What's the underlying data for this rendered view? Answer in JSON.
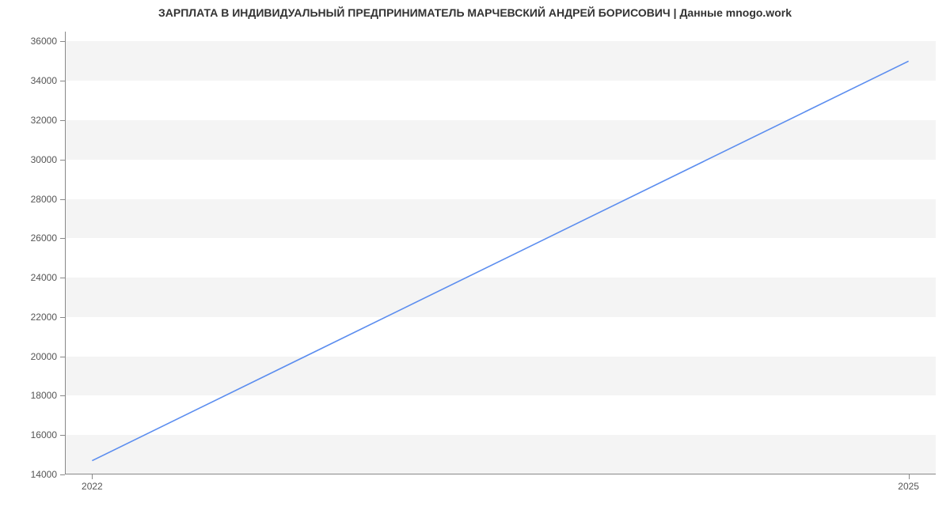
{
  "chart_data": {
    "type": "line",
    "title": "ЗАРПЛАТА В ИНДИВИДУАЛЬНЫЙ ПРЕДПРИНИМАТЕЛЬ МАРЧЕВСКИЙ АНДРЕЙ БОРИСОВИЧ | Данные mnogo.work",
    "xlabel": "",
    "ylabel": "",
    "x_ticks": [
      2022,
      2025
    ],
    "y_ticks": [
      14000,
      16000,
      18000,
      20000,
      22000,
      24000,
      26000,
      28000,
      30000,
      32000,
      34000,
      36000
    ],
    "xlim": [
      2021.9,
      2025.1
    ],
    "ylim": [
      14000,
      36500
    ],
    "series": [
      {
        "name": "salary",
        "color": "#5b8def",
        "x": [
          2022,
          2025
        ],
        "y": [
          14700,
          35000
        ]
      }
    ]
  }
}
